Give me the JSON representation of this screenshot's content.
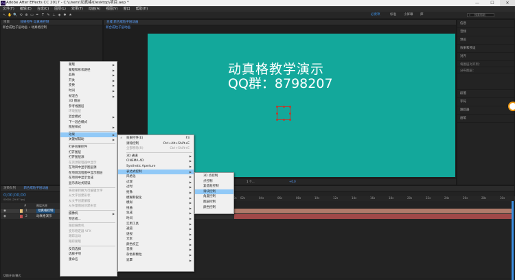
{
  "app": {
    "title": "Adobe After Effects CC 2017 - C:\\Users\\动真格\\Desktop\\项目.aep *",
    "logo": "Ae"
  },
  "window_buttons": [
    "—",
    "☐",
    "✕"
  ],
  "menubar": [
    "文件(F)",
    "编辑(E)",
    "合成(C)",
    "图层(L)",
    "效果(T)",
    "动画(A)",
    "视图(V)",
    "窗口",
    "帮助(H)"
  ],
  "toolbar": {
    "tools": [
      "↖",
      "✋",
      "🔍",
      "⟲",
      "⊕",
      "▭",
      "✒",
      "T",
      "✎",
      "⊥",
      "◈",
      "✱",
      "★"
    ],
    "workspaces": [
      "必要项",
      "标准",
      "小屏幕",
      "库"
    ],
    "active_workspace": "必要项",
    "search_placeholder": "搜索帮助"
  },
  "project_panel": {
    "tab_label": "项目",
    "effects_tab": "效果控件 动真格控制",
    "breadcrumb": "新合成粒子层动画 • 动真格控制"
  },
  "comp_panel": {
    "tab_label": "合成 新合成粒子层动画",
    "subtab": "新合成粒子层动画",
    "canvas_color": "#13a89b",
    "line1": "动真格教学演示",
    "line2": "QQ群：8798207",
    "viewer_footer": [
      "1 个...",
      "+0.0"
    ]
  },
  "right_panel": {
    "items": [
      "信息",
      "音频",
      "预览",
      "效果和预设",
      "对齐",
      "",
      "",
      "段落",
      "字符",
      "跟踪器",
      "画笔"
    ],
    "align_label": "将图层对齐到：",
    "distribute_label": "分布图层："
  },
  "timeline": {
    "tab_label": "新合成粒子层动画",
    "render_tab": "渲染队列",
    "timecode": "0;00;00;00",
    "fps_text": "00000 (29.97 fps)",
    "column_headers": [
      "#",
      "图层名称"
    ],
    "layers": [
      {
        "num": "1",
        "name": "动真格控制",
        "color": "#e8c27a"
      },
      {
        "num": "2",
        "name": "动真格演示",
        "color": "#c05050"
      }
    ],
    "ruler_ticks": [
      "0s",
      "02s",
      "04s",
      "06s",
      "08s",
      "10s",
      "12s",
      "14s",
      "16s",
      "18s",
      "20s",
      "22s",
      "24s",
      "26s",
      "28s",
      "30s"
    ],
    "footer": "切换开关/模式"
  },
  "menu_main": {
    "items": [
      {
        "label": "蒙版",
        "arrow": true
      },
      {
        "label": "蒙版和形状路径",
        "arrow": true
      },
      {
        "label": "品质",
        "arrow": true
      },
      {
        "label": "开关",
        "arrow": true
      },
      {
        "label": "变换",
        "arrow": true
      },
      {
        "label": "时间",
        "arrow": true
      },
      {
        "label": "帧混合",
        "arrow": true
      },
      {
        "label": "3D 图层"
      },
      {
        "label": "参考线图层"
      },
      {
        "label": "环境图层",
        "disabled": true
      },
      {
        "label": "混合模式",
        "arrow": true
      },
      {
        "label": "下一混合模式"
      },
      {
        "label": "图层样式",
        "arrow": true
      },
      {
        "sep": true
      },
      {
        "label": "效果",
        "arrow": true,
        "highlight": true
      },
      {
        "label": "关键帧辅助",
        "arrow": true
      },
      {
        "sep": true
      },
      {
        "label": "打开效果控件"
      },
      {
        "label": "打开图层"
      },
      {
        "label": "打开图层源"
      },
      {
        "label": "在资源管理器中显示",
        "disabled": true
      },
      {
        "label": "在项目中显示图层源"
      },
      {
        "label": "在项目流程图中显示图层"
      },
      {
        "label": "在项目中显示合成"
      },
      {
        "label": "显示表达式错误"
      },
      {
        "sep": true
      },
      {
        "label": "将效果转换为可编辑文字",
        "disabled": true
      },
      {
        "label": "从文字创建形状",
        "disabled": true
      },
      {
        "label": "从文字创建蒙版",
        "disabled": true
      },
      {
        "label": "从矢量图层创建形状",
        "disabled": true
      },
      {
        "sep": true
      },
      {
        "label": "摄像机",
        "arrow": true
      },
      {
        "label": "预合成..."
      },
      {
        "sep": true
      },
      {
        "label": "跟踪摄像机",
        "disabled": true
      },
      {
        "label": "变形稳定器 VFX",
        "disabled": true
      },
      {
        "label": "跟踪运动",
        "disabled": true
      },
      {
        "label": "跟踪蒙版",
        "disabled": true
      },
      {
        "sep": true
      },
      {
        "label": "反向选择"
      },
      {
        "label": "选择子项"
      },
      {
        "label": "重命名"
      }
    ]
  },
  "menu_effect": {
    "items": [
      {
        "label": "效果控件(E)",
        "shortcut": "F3",
        "check": true
      },
      {
        "label": "清除控制",
        "shortcut": "Ctrl+Alt+Shift+E"
      },
      {
        "label": "全部移除(R)",
        "shortcut": "Ctrl+Shift+E",
        "disabled": true
      },
      {
        "sep": true
      },
      {
        "label": "3D 通道",
        "arrow": true
      },
      {
        "label": "CINEMA 4D",
        "arrow": true
      },
      {
        "label": "Synthetic Aperture",
        "arrow": true
      },
      {
        "label": "表达式控制",
        "arrow": true,
        "highlight": true
      },
      {
        "label": "风格化",
        "arrow": true
      },
      {
        "label": "过渡",
        "arrow": true
      },
      {
        "label": "过时",
        "arrow": true
      },
      {
        "label": "抠像",
        "arrow": true
      },
      {
        "label": "模糊和锐化",
        "arrow": true
      },
      {
        "label": "模拟",
        "arrow": true
      },
      {
        "label": "扭曲",
        "arrow": true
      },
      {
        "label": "生成",
        "arrow": true
      },
      {
        "label": "时间",
        "arrow": true
      },
      {
        "label": "实用工具",
        "arrow": true
      },
      {
        "label": "通道",
        "arrow": true
      },
      {
        "label": "透视",
        "arrow": true
      },
      {
        "label": "文本",
        "arrow": true
      },
      {
        "label": "颜色校正",
        "arrow": true
      },
      {
        "label": "音频",
        "arrow": true
      },
      {
        "label": "杂色和颗粒",
        "arrow": true
      },
      {
        "label": "遮罩",
        "arrow": true
      }
    ]
  },
  "menu_expression": {
    "items": [
      {
        "label": "3D 点控制"
      },
      {
        "label": "点控制"
      },
      {
        "label": "复选框控制"
      },
      {
        "label": "滑块控制",
        "highlight": true
      },
      {
        "label": "角度控制"
      },
      {
        "label": "图层控制"
      },
      {
        "label": "颜色控制"
      }
    ]
  }
}
